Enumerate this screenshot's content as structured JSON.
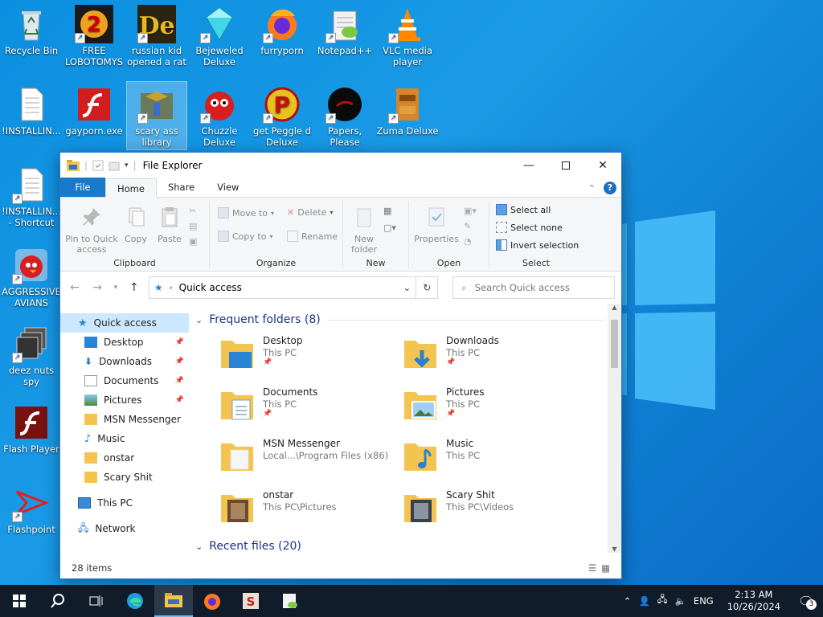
{
  "desktop_icons": [
    {
      "label": "Recycle Bin",
      "icon": "recycle-bin-icon"
    },
    {
      "label": "FREE LOBOTOMYS",
      "icon": "shortcut-app-icon"
    },
    {
      "label": "russian kid opened a rat",
      "icon": "shortcut-app-icon"
    },
    {
      "label": "Bejeweled Deluxe",
      "icon": "diamond-icon"
    },
    {
      "label": "furryporn",
      "icon": "firefox-icon"
    },
    {
      "label": "Notepad++",
      "icon": "notepad-plus-icon"
    },
    {
      "label": "VLC media player",
      "icon": "vlc-icon"
    },
    {
      "label": "!INSTALLIN...",
      "icon": "text-file-icon"
    },
    {
      "label": "gayporn.exe",
      "icon": "flash-icon"
    },
    {
      "label": "scary ass library",
      "icon": "library-icon"
    },
    {
      "label": "Chuzzle Deluxe",
      "icon": "chuzzle-icon"
    },
    {
      "label": "get Peggle d Deluxe",
      "icon": "peggle-icon"
    },
    {
      "label": "Papers, Please",
      "icon": "papers-please-icon"
    },
    {
      "label": "Zuma Deluxe",
      "icon": "zuma-icon"
    },
    {
      "label": "!INSTALLIN... - Shortcut",
      "icon": "text-file-icon"
    },
    {
      "label": "AGGRESSIVE AVIANS",
      "icon": "angry-bird-icon"
    },
    {
      "label": "deez nuts spy",
      "icon": "windows-stack-icon"
    },
    {
      "label": "Flash Player",
      "icon": "flash-icon"
    },
    {
      "label": "Flashpoint",
      "icon": "flashpoint-icon"
    }
  ],
  "explorer": {
    "title": "File Explorer",
    "tabs": [
      "File",
      "Home",
      "Share",
      "View"
    ],
    "ribbon": {
      "clipboard": {
        "label": "Clipboard",
        "pin": "Pin to Quick access",
        "copy": "Copy",
        "paste": "Paste"
      },
      "organize": {
        "label": "Organize",
        "move_to": "Move to",
        "copy_to": "Copy to",
        "delete": "Delete",
        "rename": "Rename"
      },
      "new": {
        "label": "New",
        "new_folder": "New folder"
      },
      "open": {
        "label": "Open",
        "properties": "Properties"
      },
      "select": {
        "label": "Select",
        "select_all": "Select all",
        "select_none": "Select none",
        "invert": "Invert selection"
      }
    },
    "address": {
      "path": "Quick access",
      "search_placeholder": "Search Quick access"
    },
    "nav": [
      {
        "label": "Quick access",
        "icon": "star-icon",
        "top": true,
        "selected": true
      },
      {
        "label": "Desktop",
        "icon": "desktop-icon",
        "pinned": true
      },
      {
        "label": "Downloads",
        "icon": "download-icon",
        "pinned": true
      },
      {
        "label": "Documents",
        "icon": "documents-icon",
        "pinned": true
      },
      {
        "label": "Pictures",
        "icon": "pictures-icon",
        "pinned": true
      },
      {
        "label": "MSN Messenger",
        "icon": "folder-icon"
      },
      {
        "label": "Music",
        "icon": "music-icon"
      },
      {
        "label": "onstar",
        "icon": "folder-icon"
      },
      {
        "label": "Scary Shit",
        "icon": "folder-icon"
      },
      {
        "label": "This PC",
        "icon": "computer-icon",
        "top": true
      },
      {
        "label": "Network",
        "icon": "network-icon",
        "top": true
      }
    ],
    "frequent_header": "Frequent folders (8)",
    "recent_header": "Recent files (20)",
    "folders": [
      {
        "name": "Desktop",
        "sub": "This PC",
        "pinned": true,
        "icon": "desktop-folder-icon"
      },
      {
        "name": "Downloads",
        "sub": "This PC",
        "pinned": true,
        "icon": "downloads-folder-icon"
      },
      {
        "name": "Documents",
        "sub": "This PC",
        "pinned": true,
        "icon": "documents-folder-icon"
      },
      {
        "name": "Pictures",
        "sub": "This PC",
        "pinned": true,
        "icon": "pictures-folder-icon"
      },
      {
        "name": "MSN Messenger",
        "sub": "Local...\\Program Files (x86)",
        "pinned": false,
        "icon": "folder-icon"
      },
      {
        "name": "Music",
        "sub": "This PC",
        "pinned": false,
        "icon": "music-folder-icon"
      },
      {
        "name": "onstar",
        "sub": "This PC\\Pictures",
        "pinned": false,
        "icon": "image-folder-icon"
      },
      {
        "name": "Scary Shit",
        "sub": "This PC\\Videos",
        "pinned": false,
        "icon": "video-folder-icon"
      }
    ],
    "status": "28 items"
  },
  "taskbar": {
    "apps": [
      "start-icon",
      "search-icon",
      "task-view-icon",
      "edge-icon",
      "file-explorer-icon",
      "firefox-icon",
      "sumatra-icon",
      "notepad-plus-icon"
    ],
    "language": "ENG",
    "time": "2:13 AM",
    "date": "10/26/2024",
    "notifications": "3"
  },
  "colors": {
    "accent": "#1979ca",
    "desktop": "#0f7fd2",
    "taskbar": "#101c2a"
  }
}
